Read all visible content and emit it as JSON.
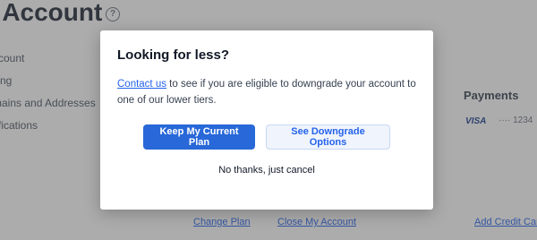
{
  "background": {
    "title": "y Account",
    "nav_items": [
      "ccount",
      "lling",
      "mains and Addresses",
      "tifications"
    ],
    "payments": {
      "heading": "Payments",
      "card_brand": "VISA",
      "card_mask": "···· 1234"
    },
    "links": {
      "change_plan": "Change Plan",
      "close_account": "Close My Account",
      "add_card": "Add Credit Card"
    }
  },
  "dialog": {
    "title": "Looking for less?",
    "body_link": "Contact us",
    "body_text": " to see if you are eligible to downgrade your account to one of our lower tiers.",
    "primary_button": "Keep My Current Plan",
    "secondary_button": "See Downgrade Options",
    "cancel_link": "No thanks, just cancel"
  },
  "colors": {
    "primary": "#2868d8",
    "link": "#2563eb",
    "overlay": "rgba(70,70,70,0.45)"
  },
  "icons": {
    "help": "question-circle-icon"
  }
}
